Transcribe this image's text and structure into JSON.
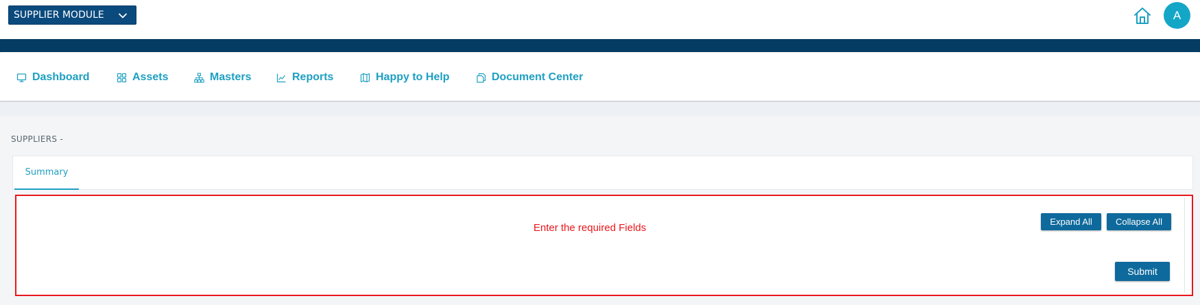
{
  "header": {
    "module_label": "SUPPLIER MODULE",
    "avatar_initial": "A"
  },
  "nav": {
    "items": [
      {
        "label": "Dashboard",
        "icon": "monitor-icon"
      },
      {
        "label": "Assets",
        "icon": "grid-icon"
      },
      {
        "label": "Masters",
        "icon": "hierarchy-icon"
      },
      {
        "label": "Reports",
        "icon": "chart-line-icon"
      },
      {
        "label": "Happy to Help",
        "icon": "map-icon"
      },
      {
        "label": "Document Center",
        "icon": "documents-icon"
      }
    ]
  },
  "page": {
    "title": "SUPPLIERS -"
  },
  "tabs": [
    {
      "label": "Summary",
      "active": true
    }
  ],
  "form": {
    "message": "Enter the required Fields",
    "expand_all": "Expand All",
    "collapse_all": "Collapse All",
    "submit": "Submit"
  },
  "colors": {
    "brand_dark": "#053c63",
    "module_button": "#0b4a7d",
    "accent": "#1d9fc2",
    "avatar": "#14a6c7",
    "button": "#0e6a9c",
    "error": "#e8161b"
  }
}
